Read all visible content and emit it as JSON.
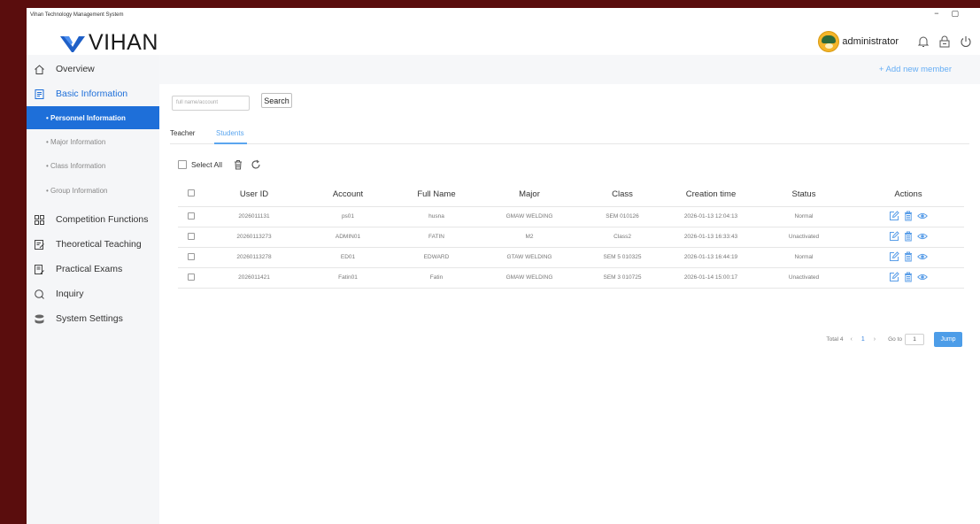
{
  "window": {
    "title": "Vihan Technology Management System",
    "controls": [
      "−",
      "▢"
    ]
  },
  "header": {
    "brand": "VIHAN",
    "username": "administrator",
    "icons": [
      "bell-icon",
      "lock-icon",
      "power-icon"
    ]
  },
  "sidebar": {
    "items": [
      {
        "label": "Overview",
        "icon": "home-icon"
      },
      {
        "label": "Basic Information",
        "icon": "document-icon"
      },
      {
        "label": "Competition Functions",
        "icon": "grid-icon"
      },
      {
        "label": "Theoretical Teaching",
        "icon": "edit-document-icon"
      },
      {
        "label": "Practical Exams",
        "icon": "exam-icon"
      },
      {
        "label": "Inquiry",
        "icon": "search-icon"
      },
      {
        "label": "System Settings",
        "icon": "database-icon"
      }
    ],
    "subitems": [
      {
        "label": "• Personnel Information"
      },
      {
        "label": "• Major Information"
      },
      {
        "label": "• Class Information"
      },
      {
        "label": "• Group Information"
      }
    ]
  },
  "main": {
    "add_member_label": "+ Add new member",
    "search_placeholder": "full name/account",
    "search_label": "Search",
    "tabs": [
      {
        "label": "Teacher"
      },
      {
        "label": "Students"
      }
    ],
    "select_all_label": "Select All",
    "accent": "#1e6fd9"
  },
  "table": {
    "columns": [
      "User ID",
      "Account",
      "Full Name",
      "Major",
      "Class",
      "Creation time",
      "Status",
      "Actions"
    ],
    "rows": [
      {
        "user_id": "2026011131",
        "account": "ps01",
        "full_name": "husna",
        "major": "GMAW WELDING",
        "class": "SEM 010126",
        "created": "2026-01-13 12:04:13",
        "status": "Normal"
      },
      {
        "user_id": "20260113273",
        "account": "ADMIN01",
        "full_name": "FATIN",
        "major": "M2",
        "class": "Class2",
        "created": "2026-01-13 16:33:43",
        "status": "Unactivated"
      },
      {
        "user_id": "20260113278",
        "account": "ED01",
        "full_name": "EDWARD",
        "major": "GTAW WELDING",
        "class": "SEM 5 010325",
        "created": "2026-01-13 16:44:19",
        "status": "Normal"
      },
      {
        "user_id": "2026011421",
        "account": "Fatin01",
        "full_name": "Fatin",
        "major": "GMAW WELDING",
        "class": "SEM 3 010725",
        "created": "2026-01-14 15:00:17",
        "status": "Unactivated"
      }
    ]
  },
  "pager": {
    "total": "Total 4",
    "prev": "‹",
    "page": "1",
    "next": "›",
    "goto_label": "Go to",
    "goto_value": "1",
    "jump": "Jump"
  }
}
